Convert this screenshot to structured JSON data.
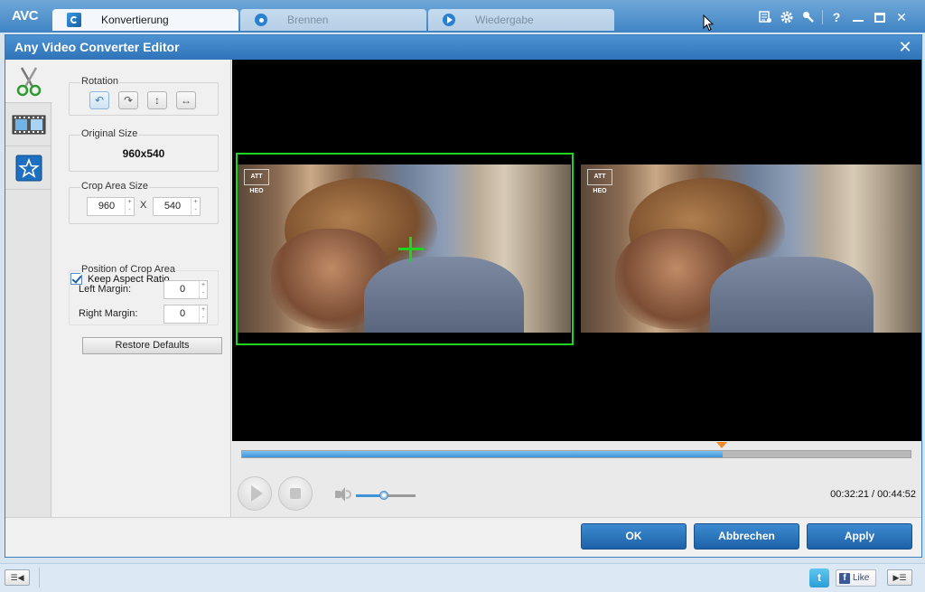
{
  "app": {
    "logo": "AVC",
    "tabs": [
      {
        "label": "Konvertierung",
        "active": true,
        "icon": "convert-icon"
      },
      {
        "label": "Brennen",
        "active": false,
        "icon": "burn-disc-icon"
      },
      {
        "label": "Wiedergabe",
        "active": false,
        "icon": "play-icon"
      }
    ],
    "window_controls": [
      "register-icon",
      "settings-gear-icon",
      "skin-icon",
      "help-icon",
      "minimize-icon",
      "maximize-icon",
      "close-icon"
    ],
    "help_glyph": "?",
    "close_glyph": "✕"
  },
  "dialog": {
    "title": "Any Video Converter Editor",
    "sidebar": [
      "crop-scissors-icon",
      "video-effects-icon",
      "watermark-star-icon"
    ],
    "rotation": {
      "label": "Rotation",
      "buttons": [
        {
          "name": "rotate-left-button",
          "glyph": "↶",
          "selected": true
        },
        {
          "name": "rotate-right-button",
          "glyph": "↷",
          "selected": false
        },
        {
          "name": "flip-vertical-button",
          "glyph": "↕",
          "selected": false
        },
        {
          "name": "flip-horizontal-button",
          "glyph": "↔",
          "selected": false
        }
      ]
    },
    "original_size": {
      "label": "Original Size",
      "value": "960x540"
    },
    "crop_area_size": {
      "label": "Crop Area Size",
      "width": "960",
      "separator": "X",
      "height": "540"
    },
    "keep_aspect_ratio": {
      "label": "Keep Aspect Ratio",
      "checked": true
    },
    "position": {
      "label": "Position of Crop Area",
      "left_margin_label": "Left Margin:",
      "left_margin_value": "0",
      "right_margin_label": "Right Margin:",
      "right_margin_value": "0"
    },
    "restore_defaults": "Restore Defaults",
    "preview": {
      "watermark_text": "ATT HEO"
    },
    "playback": {
      "progress_fraction": 0.719,
      "volume_fraction": 0.47,
      "current_time": "00:32:21",
      "total_time": "00:44:52",
      "time_separator": " / "
    },
    "buttons": {
      "ok": "OK",
      "cancel": "Abbrechen",
      "apply": "Apply"
    }
  },
  "statusbar": {
    "twitter_glyph": "t",
    "facebook_glyph": "f",
    "like_label": "Like",
    "list_glyph": "☰"
  },
  "colors": {
    "accent": "#2e73b8",
    "crop_box": "#1ed41e",
    "progress": "#3d95d8",
    "marker": "#f08a24"
  }
}
